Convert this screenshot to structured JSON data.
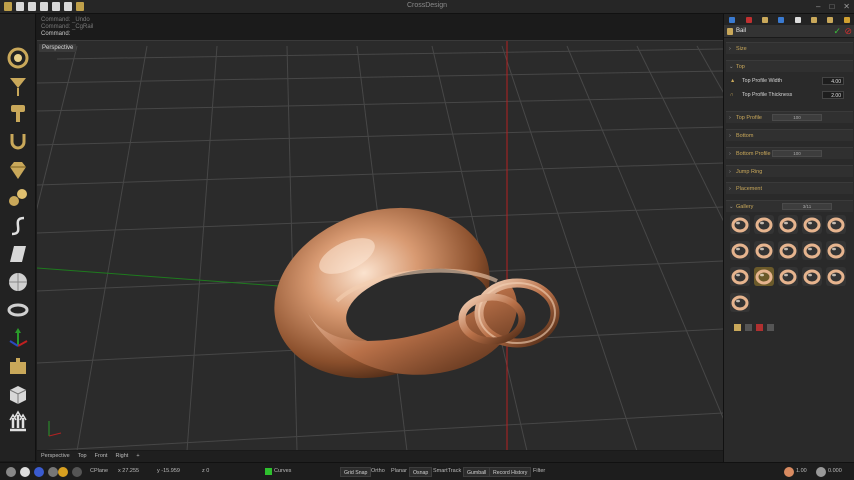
{
  "app": {
    "title": "CrossDesign"
  },
  "command": {
    "history": [
      "Command: _Undo",
      "Command: _CgRail"
    ],
    "current": "Command:"
  },
  "viewport": {
    "label": "Perspective"
  },
  "view_tabs": [
    "Perspective",
    "Top",
    "Front",
    "Right",
    "+"
  ],
  "status": {
    "cplane": "CPlane",
    "x": "x 27.255",
    "y": "y -15.959",
    "z": "z 0",
    "layer": "Curves",
    "toggles": [
      "Grid Snap",
      "Ortho",
      "Planar",
      "Osnap",
      "SmartTrack",
      "Gumball",
      "Record History",
      "Filter"
    ],
    "zoom": "1.00",
    "time": "0.000"
  },
  "panel": {
    "title": "Bail",
    "sections": {
      "size": "Size",
      "top": "Top",
      "top_profile": "Top Profile",
      "top_profile_value": "100",
      "bottom": "Bottom",
      "bottom_profile": "Bottom Profile",
      "bottom_profile_value": "100",
      "jump_ring": "Jump Ring",
      "placement": "Placement",
      "gallery": "Gallery",
      "gallery_value": "3/11"
    },
    "params": [
      {
        "label": "Top Profile Width",
        "value": "4.00"
      },
      {
        "label": "Top Profile Thickness",
        "value": "2.00"
      }
    ],
    "gallery_count": 16
  },
  "colors": {
    "accent_gold": "#c9a85a",
    "grid": "#4a4a4a",
    "axis_red": "#b32222",
    "axis_green": "#1e7a1e",
    "metal": "#d8a27f"
  }
}
